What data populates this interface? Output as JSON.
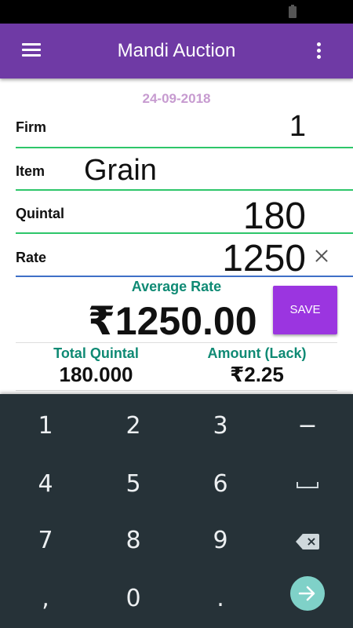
{
  "app_bar": {
    "title": "Mandi Auction",
    "menu_icon": "hamburger-menu-icon",
    "more_icon": "more-vertical-icon",
    "color": "#6f3aa5"
  },
  "form": {
    "date": "24-09-2018",
    "firm": {
      "label": "Firm",
      "value": "1"
    },
    "item": {
      "label": "Item",
      "value": "Grain"
    },
    "quintal": {
      "label": "Quintal",
      "value": "180"
    },
    "rate": {
      "label": "Rate",
      "value": "1250"
    }
  },
  "average": {
    "label": "Average Rate",
    "value": "₹1250.00",
    "save_label": "SAVE"
  },
  "summary": {
    "total_quintal_label": "Total Quintal",
    "total_quintal_value": "180.000",
    "amount_label": "Amount (Lack)",
    "amount_value": "₹2.25"
  },
  "keyboard": {
    "keys": {
      "k1": "1",
      "k2": "2",
      "k3": "3",
      "minus": "−",
      "k4": "4",
      "k5": "5",
      "k6": "6",
      "k7": "7",
      "k8": "8",
      "k9": "9",
      "comma": ",",
      "k0": "0",
      "period": "."
    },
    "background": "#263238",
    "enter_color": "#7fd1c8"
  }
}
